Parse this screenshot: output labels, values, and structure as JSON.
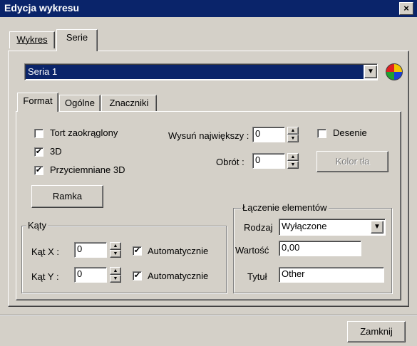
{
  "window": {
    "title": "Edycja wykresu",
    "close_glyph": "×"
  },
  "main_tabs": [
    {
      "label": "Wykres",
      "active": false
    },
    {
      "label": "Serie",
      "active": true
    }
  ],
  "series_select": {
    "value": "Seria 1",
    "arrow": "▼",
    "color_icon": "color-wheel-icon"
  },
  "sub_tabs": [
    {
      "label": "Format",
      "active": true
    },
    {
      "label": "Ogólne",
      "active": false
    },
    {
      "label": "Znaczniki",
      "active": false
    }
  ],
  "format": {
    "checkboxes": {
      "rounded_pie": {
        "label": "Tort zaokrąglony",
        "checked": false,
        "mark": ""
      },
      "three_d": {
        "label": "3D",
        "checked": true,
        "mark": "✔"
      },
      "dark_3d": {
        "label": "Przyciemniane 3D",
        "checked": true,
        "mark": "✔"
      },
      "patterns": {
        "label": "Desenie",
        "checked": false,
        "mark": ""
      }
    },
    "explode": {
      "label": "Wysuń największy :",
      "value": "0"
    },
    "rotation": {
      "label": "Obrót :",
      "value": "0"
    },
    "color_button": "Kolor tła",
    "frame_button": "Ramka",
    "spin_up": "▲",
    "spin_down": "▼"
  },
  "angles": {
    "title": "Kąty",
    "x": {
      "label": "Kąt X :",
      "value": "0",
      "auto_label": "Automatycznie",
      "auto_mark": "✔"
    },
    "y": {
      "label": "Kąt Y :",
      "value": "0",
      "auto_label": "Automatycznie",
      "auto_mark": "✔"
    }
  },
  "grouping": {
    "title": "Łączenie elementów",
    "type_label": "Rodzaj",
    "type_value": "Wyłączone",
    "value_label": "Wartość",
    "value_value": "0,00",
    "caption_label": "Tytuł",
    "caption_value": "Other",
    "arrow": "▼"
  },
  "close_button": "Zamknij",
  "colors": {
    "titlebar": "#0a246a",
    "face": "#d4d0c8",
    "selection": "#0a246a"
  }
}
